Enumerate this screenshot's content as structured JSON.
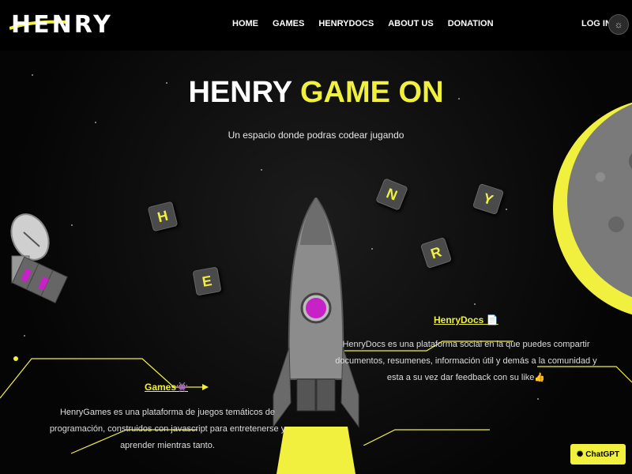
{
  "nav": {
    "logo": "HENRY",
    "links": [
      "HOME",
      "GAMES",
      "HENRYDOCS",
      "ABOUT US",
      "DONATION"
    ],
    "login": "LOG IN",
    "theme_icon": "sun-icon"
  },
  "hero": {
    "title_part1": "HENRY ",
    "title_part2": "GAME ON",
    "subtitle": "Un espacio donde podras codear jugando",
    "letters": [
      "H",
      "E",
      "N",
      "R",
      "Y"
    ]
  },
  "cards": {
    "docs_title": "HenryDocs",
    "docs_icon": "📄",
    "docs_text": "HenryDocs es una plataforma social en la que puedes compartir documentos, resumenes, información útil y demás a la comunidad y esta a su vez dar feedback con su like👍",
    "games_title": "Games",
    "games_icon": "👾",
    "games_text": "HenryGames es una plataforma de juegos temáticos de programación, construidos con javascript para entretenerse y aprender mientras tanto."
  },
  "chatgpt_label": "ChatGPT",
  "colors": {
    "accent": "#f1f03e",
    "background": "#000000"
  }
}
